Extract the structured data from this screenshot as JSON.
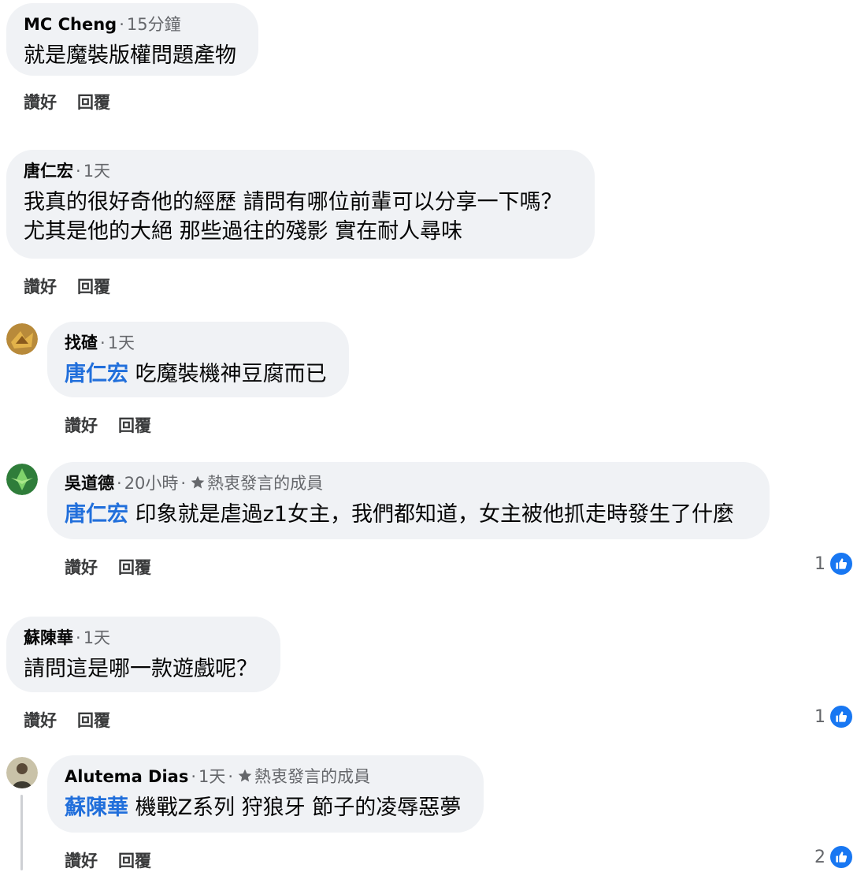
{
  "comments": [
    {
      "author": "MC Cheng",
      "time": "15分鐘",
      "text": "就是魔裝版權問題產物",
      "like_label": "讚好",
      "reply_label": "回覆"
    },
    {
      "author": "唐仁宏",
      "time": "1天",
      "text_line1": "我真的很好奇他的經歷 請問有哪位前輩可以分享一下嗎？",
      "text_line2": "尤其是他的大絕 那些過往的殘影 實在耐人尋味",
      "like_label": "讚好",
      "reply_label": "回覆",
      "replies": [
        {
          "author": "找碴",
          "time": "1天",
          "mention": "唐仁宏",
          "text": "吃魔裝機神豆腐而已",
          "like_label": "讚好",
          "reply_label": "回覆"
        },
        {
          "author": "吳道德",
          "time": "20小時",
          "badge": "熱衷發言的成員",
          "mention": "唐仁宏",
          "text": "印象就是虐過z1女主，我們都知道，女主被他抓走時發生了什麼",
          "like_label": "讚好",
          "reply_label": "回覆",
          "reaction_count": "1"
        }
      ]
    },
    {
      "author": "蘇陳華",
      "time": "1天",
      "text": "請問這是哪一款遊戲呢？",
      "like_label": "讚好",
      "reply_label": "回覆",
      "reaction_count": "1",
      "replies": [
        {
          "author": "Alutema Dias",
          "time": "1天",
          "badge": "熱衷發言的成員",
          "mention": "蘇陳華",
          "text": "機戰Z系列 狩狼牙 節子的凌辱惡夢",
          "like_label": "讚好",
          "reply_label": "回覆",
          "reaction_count": "2"
        }
      ]
    }
  ],
  "colors": {
    "bubble": "#f0f2f5",
    "mention": "#216fdb",
    "like_badge": "#1877f2"
  },
  "icons": [
    "star-icon",
    "like-icon",
    "avatar-image"
  ]
}
